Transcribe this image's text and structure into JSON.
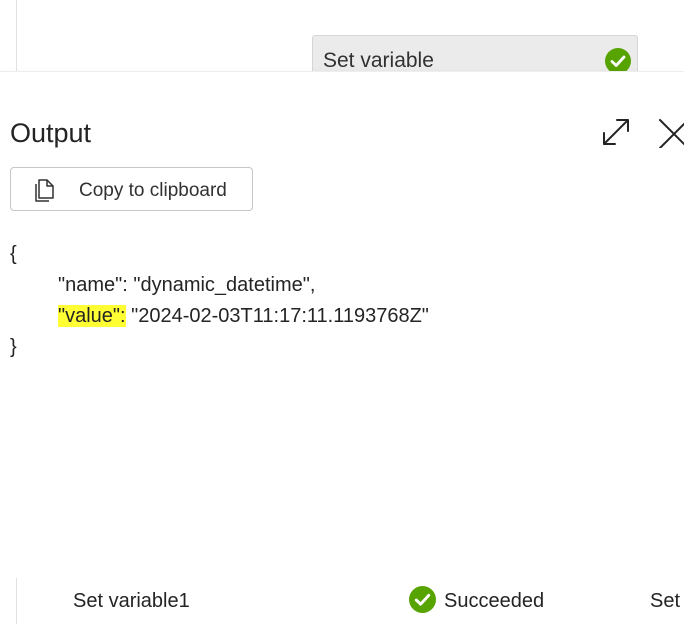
{
  "pipeline": {
    "activity_card": {
      "label": "Set variable",
      "status_icon": "checkmark-circle-icon",
      "status_color": "#57a300"
    }
  },
  "output_panel": {
    "title": "Output",
    "expand_icon": "expand-icon",
    "close_icon": "close-icon",
    "copy_button": {
      "label": "Copy to clipboard",
      "icon": "copy-icon"
    },
    "json": {
      "open": "{",
      "name_key": "\"name\":",
      "name_value": "\"dynamic_datetime\",",
      "value_key": "\"value\":",
      "value_value": "\"2024-02-03T11:17:11.1193768Z\"",
      "close": "}"
    },
    "highlight_color": "#ffff33"
  },
  "run_row": {
    "name": "Set variable1",
    "status": "Succeeded",
    "status_icon": "checkmark-circle-icon",
    "type": "Set"
  }
}
